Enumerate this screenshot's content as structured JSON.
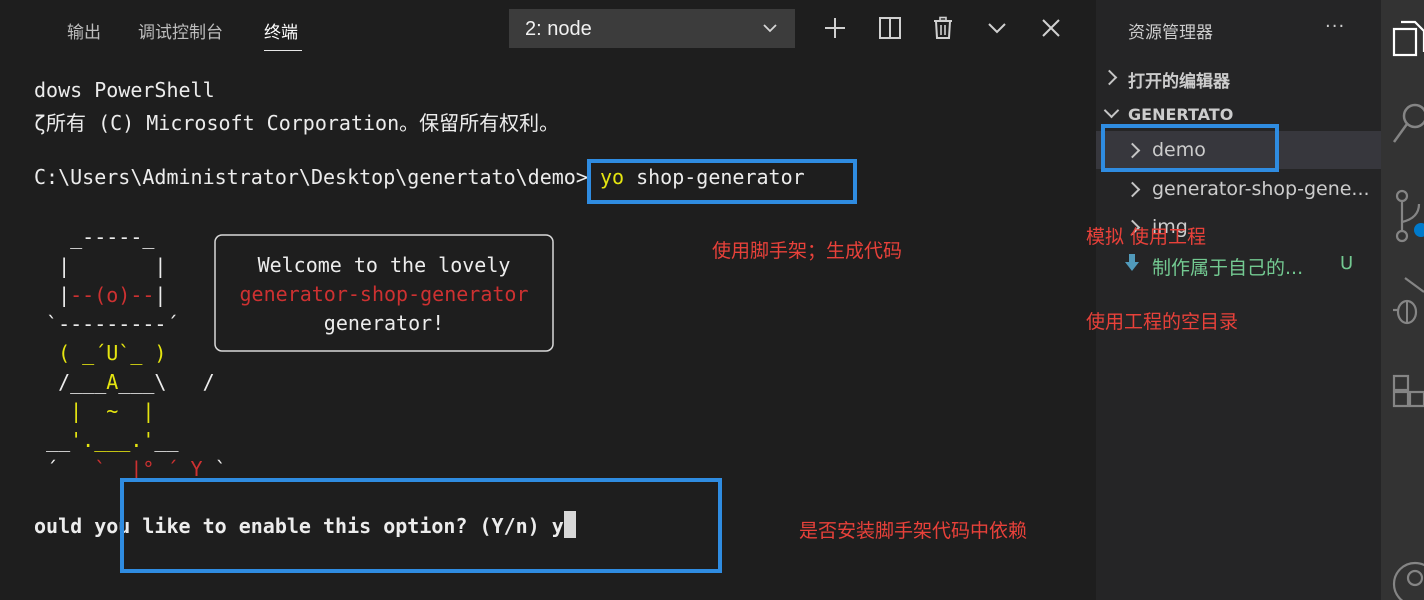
{
  "panel": {
    "tabs": [
      {
        "label": "输出"
      },
      {
        "label": "调试控制台"
      },
      {
        "label": "终端"
      }
    ],
    "terminal_select": {
      "value": "2: node"
    }
  },
  "terminal": {
    "lines": [
      "dows PowerShell",
      "ζ所有 (C) Microsoft Corporation。保留所有权利。",
      "C:\\Users\\Administrator\\Desktop\\genertato\\demo>"
    ],
    "command_yo": "yo",
    "command_arg": "shop-generator",
    "welcome": {
      "line1": "Welcome to the lovely",
      "line2": "generator-shop-generator",
      "line3": "generator!"
    },
    "prompt": "ould you like to enable this option? (Y/n)",
    "answer": "y"
  },
  "annotations": {
    "scaffold": "使用脚手架；生成代码",
    "simulate": "模拟 使用工程",
    "empty_dir": "使用工程的空目录",
    "install": "是否安装脚手架代码中依赖"
  },
  "explorer": {
    "title": "资源管理器",
    "more": "···",
    "open_editors": "打开的编辑器",
    "folder": "GENERTATO",
    "items": [
      {
        "label": "demo"
      },
      {
        "label": "generator-shop-gene..."
      },
      {
        "label": "img"
      },
      {
        "label": "制作属于自己的...",
        "badge": "U"
      }
    ]
  },
  "colors": {
    "highlight_box": "#2f8ce1",
    "annotation": "#e8413a",
    "git_untracked": "#73c991",
    "yo_yellow": "#e5e510",
    "ascii_red": "#cd3131"
  }
}
